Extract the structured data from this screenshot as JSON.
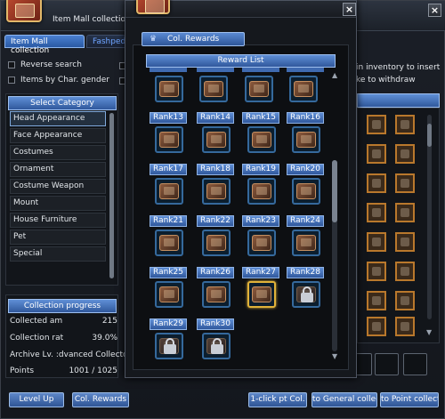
{
  "app": {
    "title": "Item Mall collection",
    "tabs": [
      {
        "label": "Item Mall collection"
      },
      {
        "label": "Fashpedia"
      }
    ]
  },
  "options": {
    "reverse_search": "Reverse search",
    "items_by_gender": "Items by Char. gender"
  },
  "category": {
    "header": "Select Category",
    "items": [
      "Head Appearance",
      "Face Appearance",
      "Costumes",
      "Ornament",
      "Costume Weapon",
      "Mount",
      "House Furniture",
      "Pet",
      "Special"
    ],
    "selected": "Head Appearance"
  },
  "progress": {
    "header": "Collection progress",
    "rows": [
      {
        "label": "Collected am",
        "value": "215"
      },
      {
        "label": "Collection rat",
        "value": "39.0%"
      },
      {
        "label": "Archive Lv. :dvanced Collector",
        "value": ""
      },
      {
        "label": "Points",
        "value": "1001 / 1025"
      }
    ]
  },
  "right_info": {
    "line1": "in inventory to insert",
    "line2": "ke to withdraw"
  },
  "bottom_buttons": {
    "level_up": "Level Up",
    "col_rewards": "Col. Rewards",
    "one_click": "1-click pt Col.",
    "to_general": "to General collec",
    "to_point": "to Point collect"
  },
  "reward_window": {
    "header": "Col. Rewards",
    "list_header": "Reward List",
    "ranks": [
      {
        "label": "Rank13",
        "state": "available"
      },
      {
        "label": "Rank14",
        "state": "available"
      },
      {
        "label": "Rank15",
        "state": "available"
      },
      {
        "label": "Rank16",
        "state": "available"
      },
      {
        "label": "Rank17",
        "state": "available"
      },
      {
        "label": "Rank18",
        "state": "available"
      },
      {
        "label": "Rank19",
        "state": "available"
      },
      {
        "label": "Rank20",
        "state": "available"
      },
      {
        "label": "Rank21",
        "state": "available"
      },
      {
        "label": "Rank22",
        "state": "available"
      },
      {
        "label": "Rank23",
        "state": "available"
      },
      {
        "label": "Rank24",
        "state": "available"
      },
      {
        "label": "Rank25",
        "state": "available"
      },
      {
        "label": "Rank26",
        "state": "available"
      },
      {
        "label": "Rank27",
        "state": "highlighted"
      },
      {
        "label": "Rank28",
        "state": "locked"
      },
      {
        "label": "Rank29",
        "state": "locked"
      },
      {
        "label": "Rank30",
        "state": "locked"
      }
    ]
  },
  "colors": {
    "accent_blue": "#4a7fd0",
    "highlight_gold": "#e0b23a",
    "slot_border": "#35699c"
  }
}
